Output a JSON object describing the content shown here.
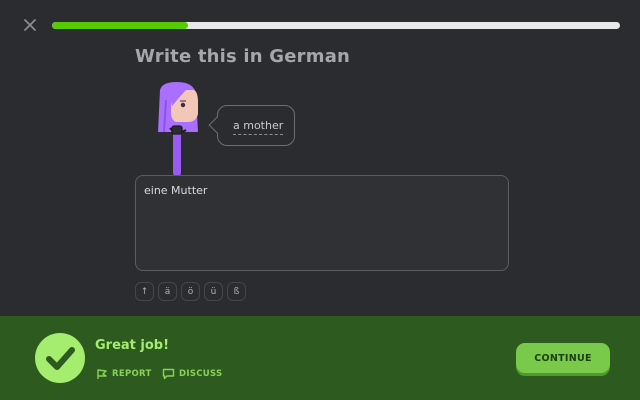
{
  "header": {
    "progress": 0.24
  },
  "challenge": {
    "title": "Write this in German",
    "bubble_text": "a mother"
  },
  "answer": {
    "value": "eine Mutter"
  },
  "keyboard": {
    "keys": [
      "↑",
      "ä",
      "ö",
      "ü",
      "ß"
    ]
  },
  "feedback": {
    "message": "Great job!",
    "report_label": "REPORT",
    "discuss_label": "DISCUSS",
    "continue_label": "CONTINUE"
  },
  "colors": {
    "progress": "#58cc02",
    "footer_bg": "#2d5a1f",
    "success": "#a5ed6e",
    "continue_bg": "#79c94a",
    "character": "#a970ff"
  }
}
